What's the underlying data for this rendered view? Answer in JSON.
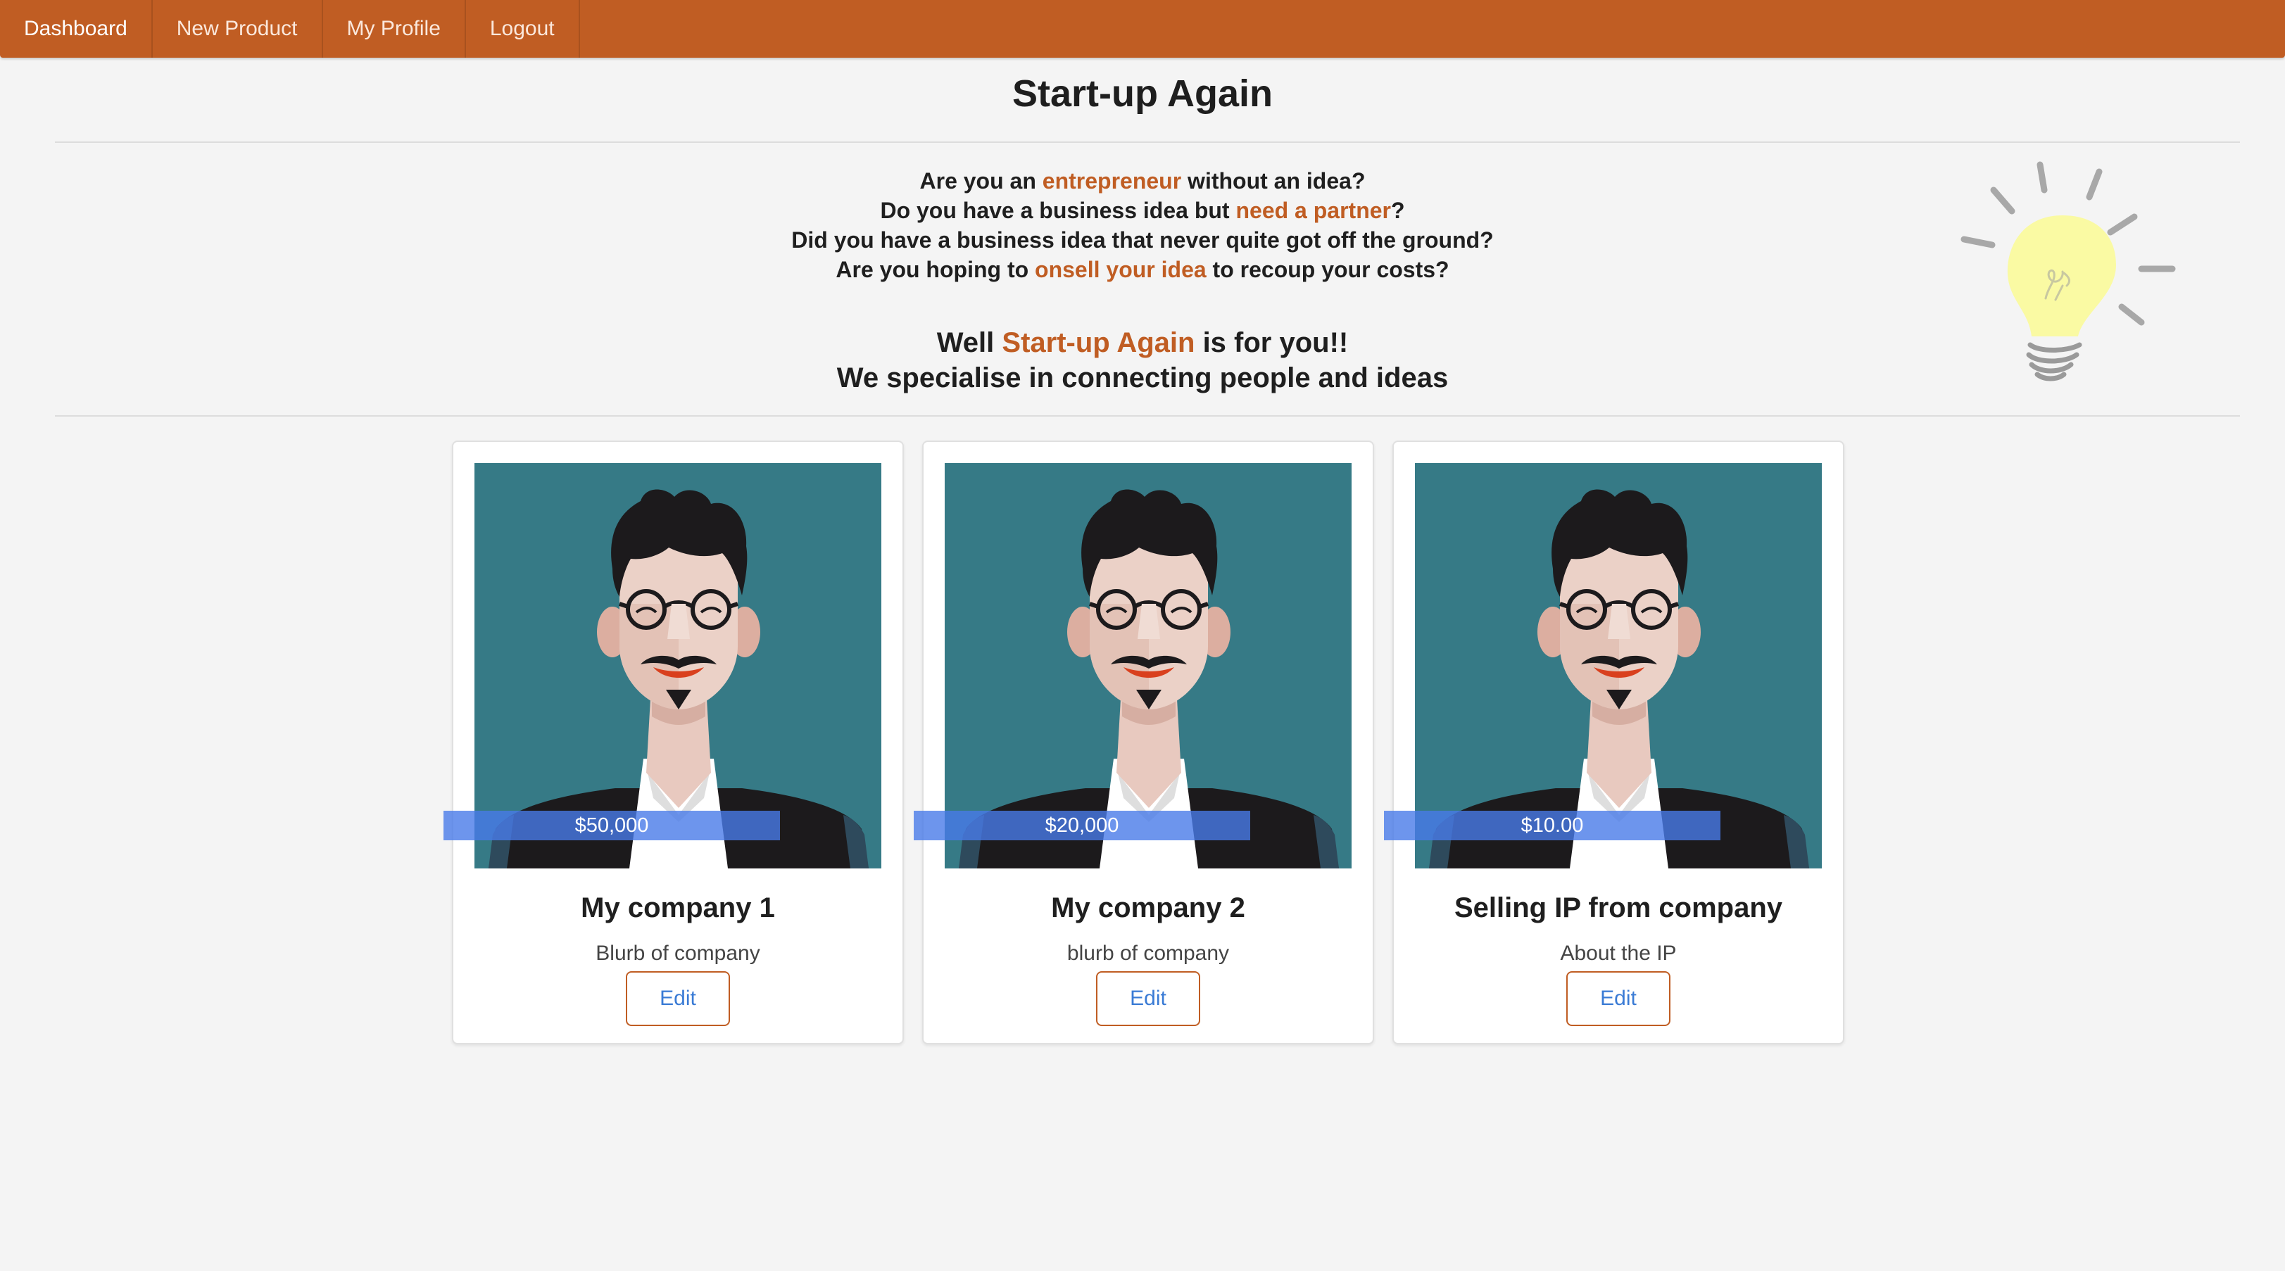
{
  "nav": {
    "items": [
      {
        "label": "Dashboard"
      },
      {
        "label": "New Product"
      },
      {
        "label": "My Profile"
      },
      {
        "label": "Logout"
      }
    ]
  },
  "header": {
    "title": "Start-up Again"
  },
  "intro": {
    "q1_pre": "Are you an ",
    "q1_hl": "entrepreneur",
    "q1_post": " without an idea?",
    "q2_pre": "Do you have a business idea but ",
    "q2_hl": "need a partner",
    "q2_post": "?",
    "q3": "Did you have a business idea that never quite got off the ground?",
    "q4_pre": "Are you hoping to ",
    "q4_hl": "onsell your idea",
    "q4_post": " to recoup your costs?",
    "tag1_pre": "Well ",
    "tag1_hl": "Start-up Again",
    "tag1_post": " is for you!!",
    "tag2": "We specialise in connecting people and ideas"
  },
  "products": [
    {
      "price": "$50,000",
      "title": "My company 1",
      "blurb": "Blurb of company",
      "edit_label": "Edit"
    },
    {
      "price": "$20,000",
      "title": "My company 2",
      "blurb": "blurb of company",
      "edit_label": "Edit"
    },
    {
      "price": "$10.00",
      "title": "Selling IP from company",
      "blurb": "About the IP",
      "edit_label": "Edit"
    }
  ],
  "colors": {
    "navbar": "#c05d23",
    "accent": "#c05d23",
    "link": "#3a7bd5",
    "portrait_bg": "#367a86",
    "price_band": "#487ae8"
  },
  "icons": {
    "logo": "lightbulb-icon",
    "portrait": "avatar-illustration"
  }
}
